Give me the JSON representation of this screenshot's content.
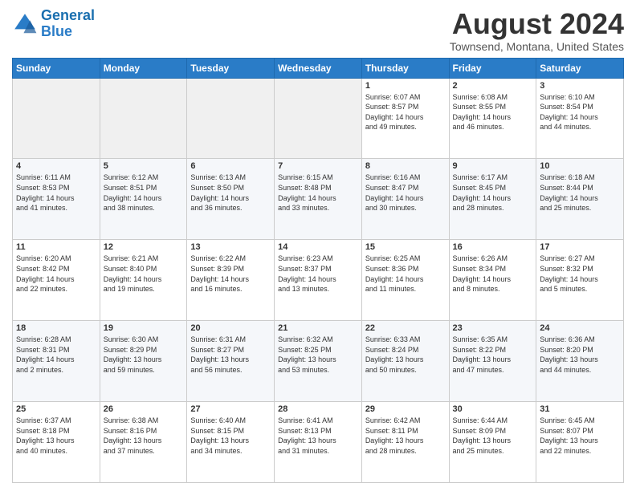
{
  "header": {
    "logo_line1": "General",
    "logo_line2": "Blue",
    "title": "August 2024",
    "subtitle": "Townsend, Montana, United States"
  },
  "weekdays": [
    "Sunday",
    "Monday",
    "Tuesday",
    "Wednesday",
    "Thursday",
    "Friday",
    "Saturday"
  ],
  "weeks": [
    [
      {
        "day": "",
        "info": ""
      },
      {
        "day": "",
        "info": ""
      },
      {
        "day": "",
        "info": ""
      },
      {
        "day": "",
        "info": ""
      },
      {
        "day": "1",
        "info": "Sunrise: 6:07 AM\nSunset: 8:57 PM\nDaylight: 14 hours\nand 49 minutes."
      },
      {
        "day": "2",
        "info": "Sunrise: 6:08 AM\nSunset: 8:55 PM\nDaylight: 14 hours\nand 46 minutes."
      },
      {
        "day": "3",
        "info": "Sunrise: 6:10 AM\nSunset: 8:54 PM\nDaylight: 14 hours\nand 44 minutes."
      }
    ],
    [
      {
        "day": "4",
        "info": "Sunrise: 6:11 AM\nSunset: 8:53 PM\nDaylight: 14 hours\nand 41 minutes."
      },
      {
        "day": "5",
        "info": "Sunrise: 6:12 AM\nSunset: 8:51 PM\nDaylight: 14 hours\nand 38 minutes."
      },
      {
        "day": "6",
        "info": "Sunrise: 6:13 AM\nSunset: 8:50 PM\nDaylight: 14 hours\nand 36 minutes."
      },
      {
        "day": "7",
        "info": "Sunrise: 6:15 AM\nSunset: 8:48 PM\nDaylight: 14 hours\nand 33 minutes."
      },
      {
        "day": "8",
        "info": "Sunrise: 6:16 AM\nSunset: 8:47 PM\nDaylight: 14 hours\nand 30 minutes."
      },
      {
        "day": "9",
        "info": "Sunrise: 6:17 AM\nSunset: 8:45 PM\nDaylight: 14 hours\nand 28 minutes."
      },
      {
        "day": "10",
        "info": "Sunrise: 6:18 AM\nSunset: 8:44 PM\nDaylight: 14 hours\nand 25 minutes."
      }
    ],
    [
      {
        "day": "11",
        "info": "Sunrise: 6:20 AM\nSunset: 8:42 PM\nDaylight: 14 hours\nand 22 minutes."
      },
      {
        "day": "12",
        "info": "Sunrise: 6:21 AM\nSunset: 8:40 PM\nDaylight: 14 hours\nand 19 minutes."
      },
      {
        "day": "13",
        "info": "Sunrise: 6:22 AM\nSunset: 8:39 PM\nDaylight: 14 hours\nand 16 minutes."
      },
      {
        "day": "14",
        "info": "Sunrise: 6:23 AM\nSunset: 8:37 PM\nDaylight: 14 hours\nand 13 minutes."
      },
      {
        "day": "15",
        "info": "Sunrise: 6:25 AM\nSunset: 8:36 PM\nDaylight: 14 hours\nand 11 minutes."
      },
      {
        "day": "16",
        "info": "Sunrise: 6:26 AM\nSunset: 8:34 PM\nDaylight: 14 hours\nand 8 minutes."
      },
      {
        "day": "17",
        "info": "Sunrise: 6:27 AM\nSunset: 8:32 PM\nDaylight: 14 hours\nand 5 minutes."
      }
    ],
    [
      {
        "day": "18",
        "info": "Sunrise: 6:28 AM\nSunset: 8:31 PM\nDaylight: 14 hours\nand 2 minutes."
      },
      {
        "day": "19",
        "info": "Sunrise: 6:30 AM\nSunset: 8:29 PM\nDaylight: 13 hours\nand 59 minutes."
      },
      {
        "day": "20",
        "info": "Sunrise: 6:31 AM\nSunset: 8:27 PM\nDaylight: 13 hours\nand 56 minutes."
      },
      {
        "day": "21",
        "info": "Sunrise: 6:32 AM\nSunset: 8:25 PM\nDaylight: 13 hours\nand 53 minutes."
      },
      {
        "day": "22",
        "info": "Sunrise: 6:33 AM\nSunset: 8:24 PM\nDaylight: 13 hours\nand 50 minutes."
      },
      {
        "day": "23",
        "info": "Sunrise: 6:35 AM\nSunset: 8:22 PM\nDaylight: 13 hours\nand 47 minutes."
      },
      {
        "day": "24",
        "info": "Sunrise: 6:36 AM\nSunset: 8:20 PM\nDaylight: 13 hours\nand 44 minutes."
      }
    ],
    [
      {
        "day": "25",
        "info": "Sunrise: 6:37 AM\nSunset: 8:18 PM\nDaylight: 13 hours\nand 40 minutes."
      },
      {
        "day": "26",
        "info": "Sunrise: 6:38 AM\nSunset: 8:16 PM\nDaylight: 13 hours\nand 37 minutes."
      },
      {
        "day": "27",
        "info": "Sunrise: 6:40 AM\nSunset: 8:15 PM\nDaylight: 13 hours\nand 34 minutes."
      },
      {
        "day": "28",
        "info": "Sunrise: 6:41 AM\nSunset: 8:13 PM\nDaylight: 13 hours\nand 31 minutes."
      },
      {
        "day": "29",
        "info": "Sunrise: 6:42 AM\nSunset: 8:11 PM\nDaylight: 13 hours\nand 28 minutes."
      },
      {
        "day": "30",
        "info": "Sunrise: 6:44 AM\nSunset: 8:09 PM\nDaylight: 13 hours\nand 25 minutes."
      },
      {
        "day": "31",
        "info": "Sunrise: 6:45 AM\nSunset: 8:07 PM\nDaylight: 13 hours\nand 22 minutes."
      }
    ]
  ]
}
